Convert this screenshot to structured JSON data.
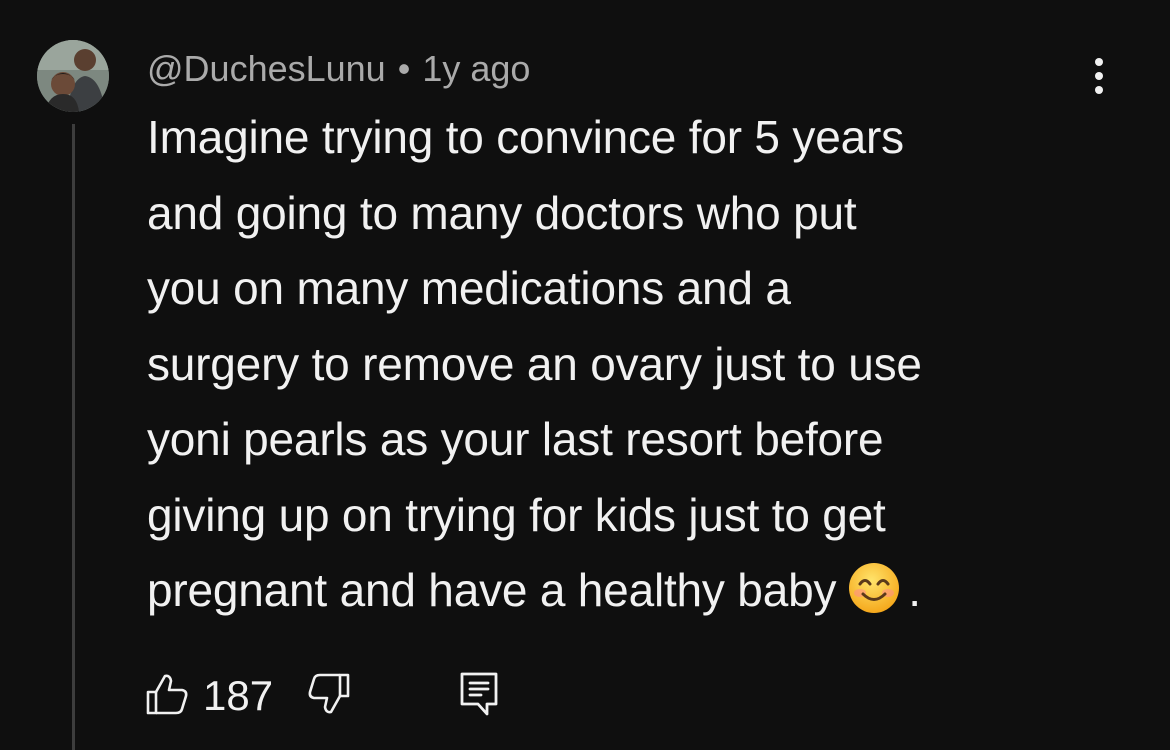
{
  "comment": {
    "author": "@DuchesLunu",
    "separator": "•",
    "time": "1y ago",
    "text_lines": [
      "Imagine trying to convince for 5 years",
      "and going to many doctors who put",
      "you on many medications and a",
      "surgery to remove an ovary just to use",
      "yoni pearls as your last resort before",
      "giving up on trying for kids just to get",
      "pregnant and have a healthy baby"
    ],
    "trailing_punctuation": ".",
    "emoji": "smiling-face-with-smiling-eyes",
    "like_count": "187"
  },
  "icons": {
    "more": "more-vertical-icon",
    "like": "thumbs-up-icon",
    "dislike": "thumbs-down-icon",
    "reply": "comment-reply-icon"
  },
  "colors": {
    "background": "#0f0f0f",
    "primary_text": "#f1f1f1",
    "secondary_text": "#aaaaaa",
    "thread_line": "#3d3d3d"
  }
}
